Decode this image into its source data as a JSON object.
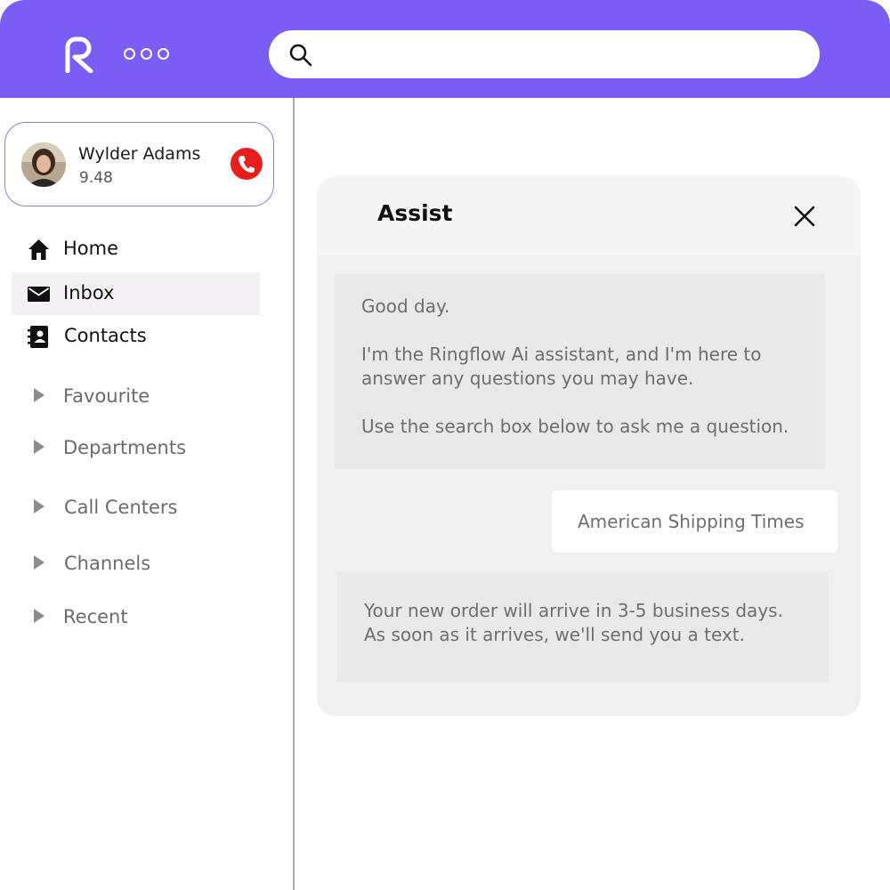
{
  "topbar": {
    "logo": "ringflow-logo",
    "menu_dots_icon": "more-dots-icon",
    "search": {
      "placeholder": "",
      "value": "",
      "icon": "search-icon"
    },
    "accent_color": "#7b5cf5"
  },
  "profile": {
    "name": "Wylder Adams",
    "score": "9.48",
    "call_icon": "phone-icon",
    "call_color": "#e61e1e"
  },
  "nav": {
    "items": [
      {
        "label": "Home",
        "icon": "home-icon",
        "active": false
      },
      {
        "label": "Inbox",
        "icon": "mail-icon",
        "active": true
      },
      {
        "label": "Contacts",
        "icon": "contacts-icon",
        "active": false
      }
    ],
    "groups": [
      {
        "label": "Favourite"
      },
      {
        "label": "Departments"
      },
      {
        "label": "Call Centers"
      },
      {
        "label": "Channels"
      },
      {
        "label": "Recent"
      }
    ]
  },
  "assist": {
    "title": "Assist",
    "close_icon": "close-icon",
    "messages": [
      {
        "from": "bot",
        "lines": [
          "Good day.",
          " I'm the Ringflow Ai assistant, and I'm here to\nanswer any questions you may have.",
          "Use the search box below to ask me a question."
        ]
      },
      {
        "from": "user",
        "text": "American Shipping Times"
      },
      {
        "from": "bot",
        "text": "Your new order will arrive in 3-5 business days.\nAs soon as it arrives, we'll send you a text."
      }
    ]
  }
}
